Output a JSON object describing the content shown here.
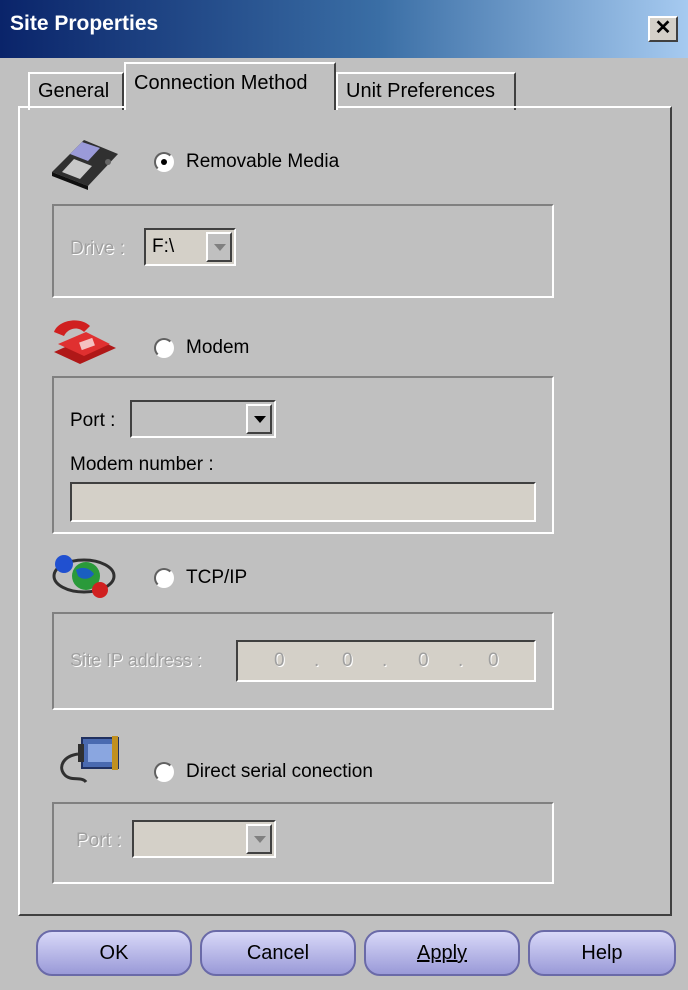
{
  "window": {
    "title": "Site Properties",
    "close_glyph": "✕"
  },
  "tabs": [
    {
      "label": "General"
    },
    {
      "label": "Connection Method"
    },
    {
      "label": "Unit Preferences"
    }
  ],
  "removable": {
    "icon": "floppy-disk-icon",
    "label": "Removable Media",
    "checked": true,
    "drive_label": "Drive :",
    "drive_value": "F:\\"
  },
  "modem": {
    "icon": "telephone-icon",
    "label": "Modem",
    "checked": false,
    "port_label": "Port :",
    "port_value": "",
    "number_label": "Modem number :",
    "number_value": ""
  },
  "tcpip": {
    "icon": "network-globe-icon",
    "label": "TCP/IP",
    "checked": false,
    "ip_label": "Site IP address :",
    "ip": [
      "0",
      "0",
      "0",
      "0"
    ],
    "ip_dot": "."
  },
  "serial": {
    "icon": "serial-connector-icon",
    "label": "Direct serial conection",
    "checked": false,
    "port_label": "Port :",
    "port_value": ""
  },
  "buttons": {
    "ok": "OK",
    "cancel": "Cancel",
    "apply": "Apply",
    "help": "Help"
  },
  "colors": {
    "titlebar": "#0a246a",
    "button_face": "#a8a8e0",
    "dialog": "#c0c0c0"
  }
}
